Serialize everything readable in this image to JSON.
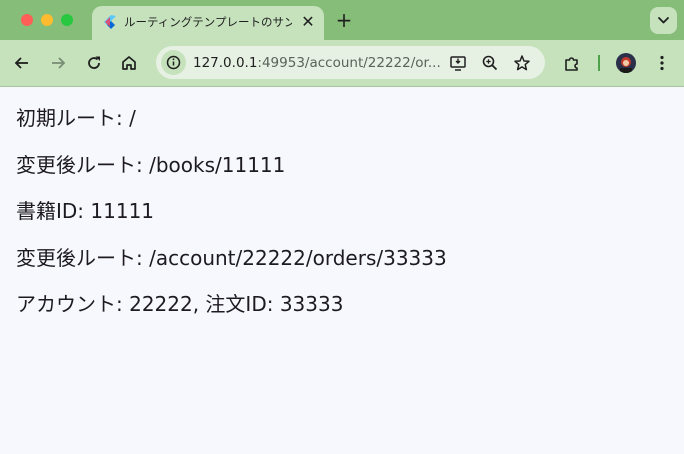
{
  "browser": {
    "tab": {
      "title": "ルーティングテンプレートのサンプル",
      "favicon": "flutter-icon"
    },
    "url": {
      "host": "127.0.0.1",
      "rest": ":49953/account/22222/or..."
    },
    "icons": {
      "back": "back-arrow-icon",
      "forward": "forward-arrow-icon",
      "reload": "reload-icon",
      "home": "home-icon",
      "site_info": "site-info-icon",
      "install": "install-app-icon",
      "zoom": "zoom-icon",
      "bookmark": "star-icon",
      "extensions": "extensions-icon",
      "menu": "more-vert-icon",
      "tab_search": "chevron-down-icon",
      "new_tab": "plus-icon",
      "close_tab": "close-icon"
    },
    "colors": {
      "frame": "#86bd79",
      "toolbar": "#c5e2bc",
      "omnibox": "#e7f1e3",
      "page_background": "#f7f8fe"
    }
  },
  "page": {
    "lines": [
      "初期ルート: /",
      "変更後ルート: /books/11111",
      "書籍ID: 11111",
      "変更後ルート: /account/22222/orders/33333",
      "アカウント: 22222, 注文ID: 33333"
    ]
  }
}
